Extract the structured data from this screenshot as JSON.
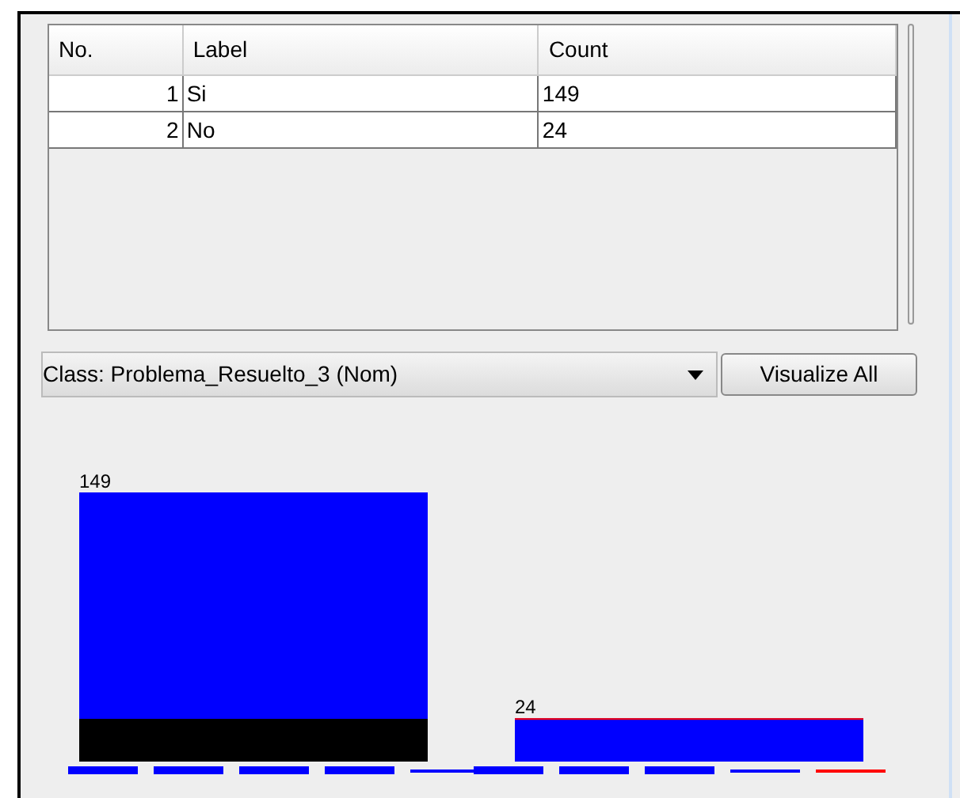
{
  "table": {
    "columns": [
      "No.",
      "Label",
      "Count"
    ],
    "rows": [
      [
        "1",
        "Si",
        "149"
      ],
      [
        "2",
        "No",
        "24"
      ]
    ]
  },
  "class_selector": {
    "value": "Class: Problema_Resuelto_3 (Nom)"
  },
  "buttons": [
    "Visualize All"
  ],
  "histogram": {
    "chart_data": {
      "type": "bar",
      "data_labels": true,
      "series": [
        {
          "color": "#0000ff",
          "values": [
            149,
            24
          ]
        }
      ]
    }
  }
}
